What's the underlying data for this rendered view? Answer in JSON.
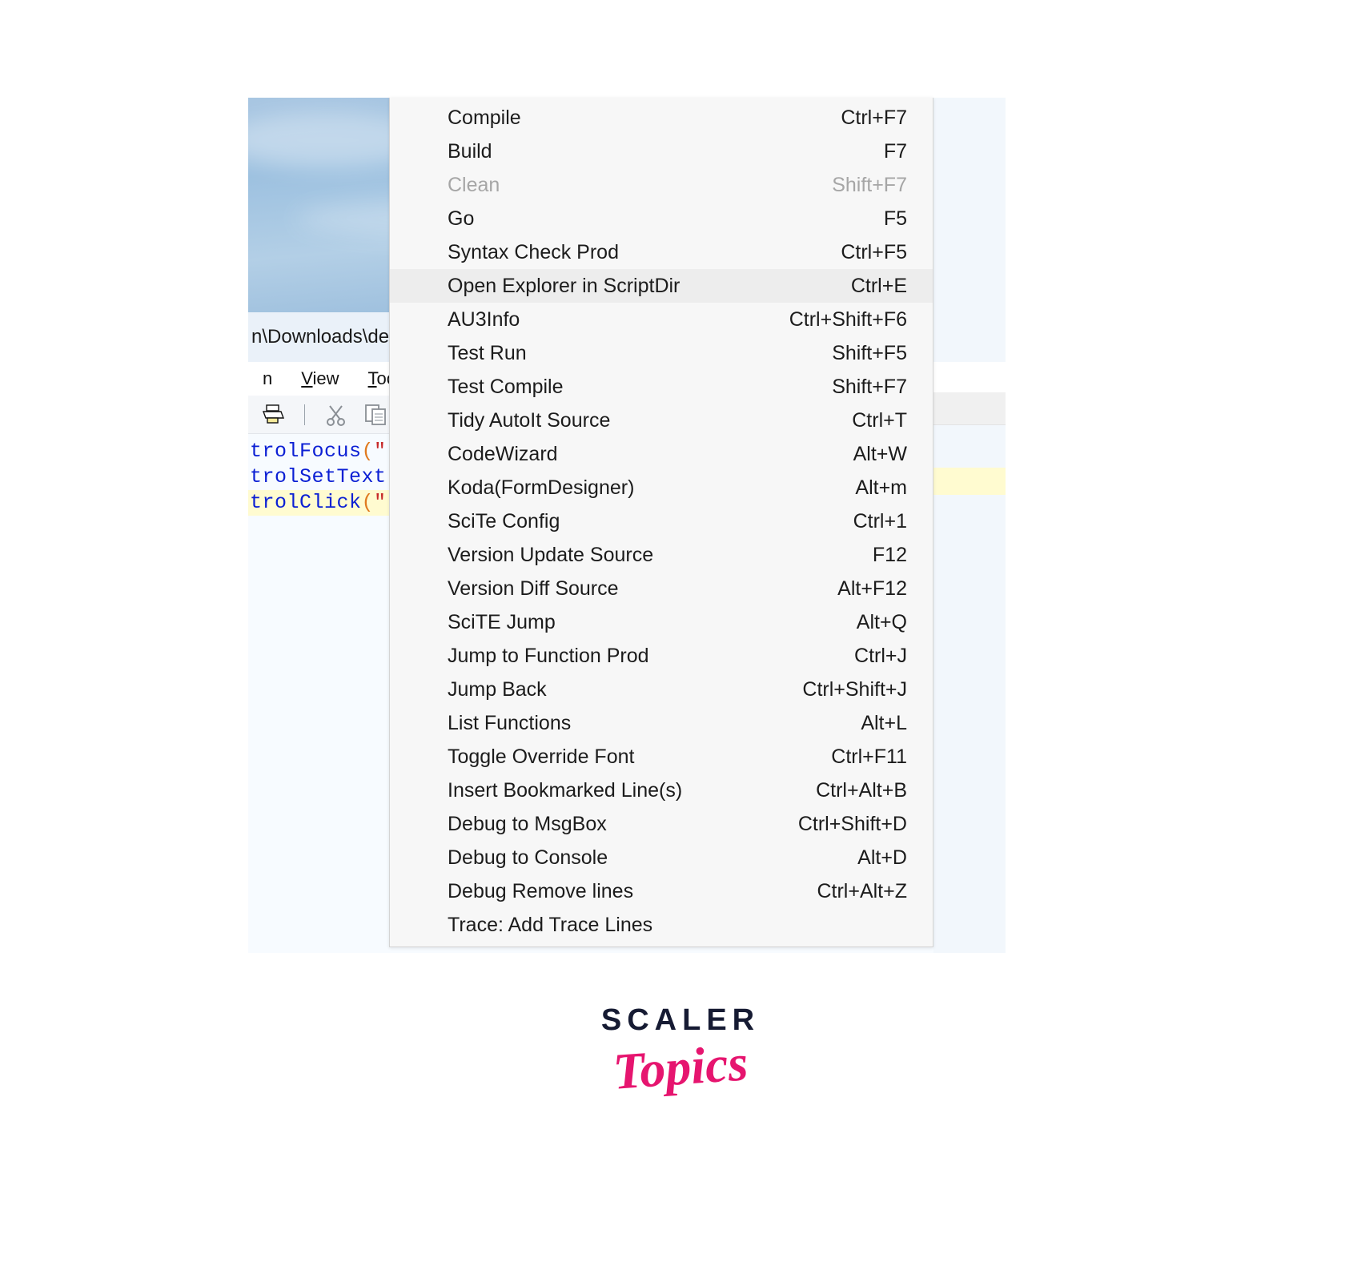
{
  "editor": {
    "title_path": "n\\Downloads\\dem",
    "menubar": [
      {
        "label": "n",
        "accel": ""
      },
      {
        "label": "View",
        "accel": "V"
      },
      {
        "label": "Tools",
        "accel": "T"
      }
    ],
    "toolbar_icons": [
      "print-icon",
      "cut-icon",
      "copy-icon",
      "paste-icon"
    ],
    "code_lines": [
      {
        "fn": "trolFocus",
        "paren": "(",
        "str": "\"(",
        "highlight": false
      },
      {
        "fn": "trolSetText",
        "paren": "",
        "str": "",
        "highlight": false
      },
      {
        "fn": "trolClick",
        "paren": "(",
        "str": "\"(",
        "highlight": true
      }
    ]
  },
  "popup_menu": {
    "name": "tools-menu",
    "items": [
      {
        "label": "Compile",
        "accel": "Ctrl+F7",
        "disabled": false,
        "highlight": false
      },
      {
        "label": "Build",
        "accel": "F7",
        "disabled": false,
        "highlight": false
      },
      {
        "label": "Clean",
        "accel": "Shift+F7",
        "disabled": true,
        "highlight": false
      },
      {
        "label": "Go",
        "accel": "F5",
        "disabled": false,
        "highlight": false
      },
      {
        "label": "Syntax Check Prod",
        "accel": "Ctrl+F5",
        "disabled": false,
        "highlight": false
      },
      {
        "label": "Open Explorer in ScriptDir",
        "accel": "Ctrl+E",
        "disabled": false,
        "highlight": true
      },
      {
        "label": "AU3Info",
        "accel": "Ctrl+Shift+F6",
        "disabled": false,
        "highlight": false
      },
      {
        "label": "Test Run",
        "accel": "Shift+F5",
        "disabled": false,
        "highlight": false
      },
      {
        "label": "Test Compile",
        "accel": "Shift+F7",
        "disabled": false,
        "highlight": false
      },
      {
        "label": "Tidy AutoIt Source",
        "accel": "Ctrl+T",
        "disabled": false,
        "highlight": false
      },
      {
        "label": "CodeWizard",
        "accel": "Alt+W",
        "disabled": false,
        "highlight": false
      },
      {
        "label": "Koda(FormDesigner)",
        "accel": "Alt+m",
        "disabled": false,
        "highlight": false
      },
      {
        "label": "SciTe Config",
        "accel": "Ctrl+1",
        "disabled": false,
        "highlight": false
      },
      {
        "label": "Version Update Source",
        "accel": "F12",
        "disabled": false,
        "highlight": false
      },
      {
        "label": "Version Diff Source",
        "accel": "Alt+F12",
        "disabled": false,
        "highlight": false
      },
      {
        "label": "SciTE Jump",
        "accel": "Alt+Q",
        "disabled": false,
        "highlight": false
      },
      {
        "label": "Jump to Function Prod",
        "accel": "Ctrl+J",
        "disabled": false,
        "highlight": false
      },
      {
        "label": "Jump Back",
        "accel": "Ctrl+Shift+J",
        "disabled": false,
        "highlight": false
      },
      {
        "label": "List Functions",
        "accel": "Alt+L",
        "disabled": false,
        "highlight": false
      },
      {
        "label": "Toggle Override Font",
        "accel": "Ctrl+F11",
        "disabled": false,
        "highlight": false
      },
      {
        "label": "Insert Bookmarked Line(s)",
        "accel": "Ctrl+Alt+B",
        "disabled": false,
        "highlight": false
      },
      {
        "label": "Debug to MsgBox",
        "accel": "Ctrl+Shift+D",
        "disabled": false,
        "highlight": false
      },
      {
        "label": "Debug to Console",
        "accel": "Alt+D",
        "disabled": false,
        "highlight": false
      },
      {
        "label": "Debug Remove lines",
        "accel": "Ctrl+Alt+Z",
        "disabled": false,
        "highlight": false
      },
      {
        "label": "Trace: Add Trace Lines",
        "accel": "",
        "disabled": false,
        "highlight": false
      }
    ]
  },
  "logo": {
    "primary": "SCALER",
    "secondary": "Topics",
    "primary_color": "#161B33",
    "secondary_color": "#E6156F"
  }
}
